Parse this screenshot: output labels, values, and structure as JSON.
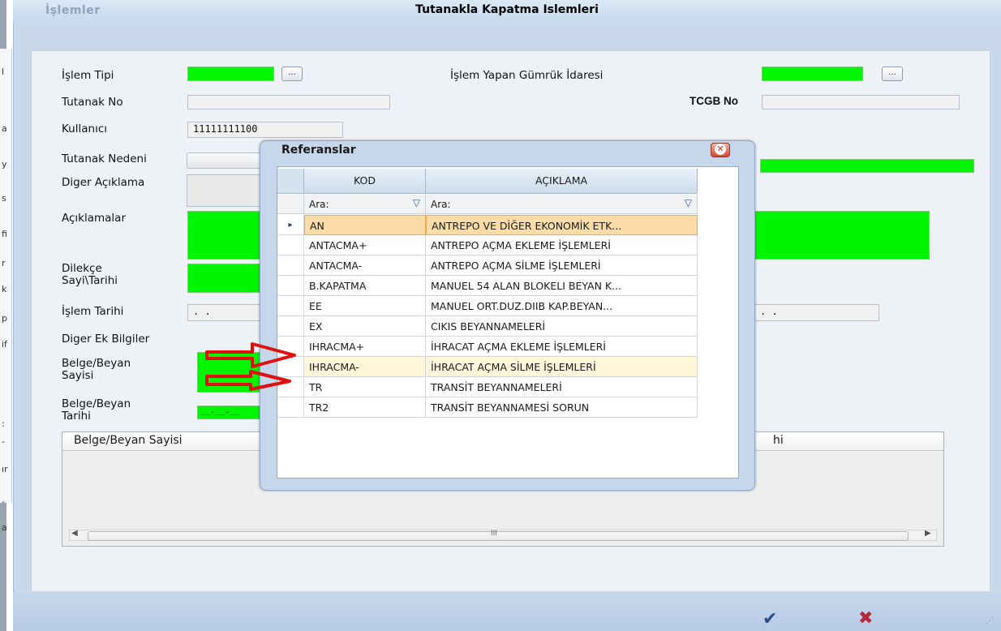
{
  "window": {
    "title_left": "İşlemler",
    "title": "Tutanakla Kapatma Islemleri"
  },
  "left_strip_letters": [
    "l",
    "a",
    "y",
    "s",
    "fi",
    "r",
    "k",
    "p",
    "if",
    ":",
    "-",
    "ır",
    "-",
    "a"
  ],
  "form": {
    "islem_tipi": "İşlem Tipi",
    "islem_yapan": "İşlem Yapan Gümrük İdaresi",
    "tutanak_no": "Tutanak No",
    "tcgb_no": "TCGB No",
    "kullanici": "Kullanıcı",
    "kullanici_value": "11111111100",
    "tutanak_nedeni": "Tutanak Nedeni",
    "diger_aciklama": "Diger Açıklama",
    "aciklamalar": "Açıklamalar",
    "dilekce_1": "Dilekçe",
    "dilekce_2": "Sayi\\Tarihi",
    "islem_tarihi": "İşlem Tarihi",
    "islem_tarihi_value": ". .",
    "right_date_value": ". .",
    "diger_ek": "Diger Ek Bilgiler",
    "belge_sayisi_1": "Belge/Beyan",
    "belge_sayisi_2": "Sayisi",
    "belge_tarihi_1": "Belge/Beyan",
    "belge_tarihi_2": "Tarihi",
    "dots_label": "...",
    "date_mask": "__.__.__"
  },
  "grid": {
    "col1": "Belge/Beyan Sayisi",
    "col2_partial": "hi",
    "scroll_grip": "III"
  },
  "dialog": {
    "title": "Referanslar",
    "close": "✕",
    "col_kod": "KOD",
    "col_aciklama": "AÇIKLAMA",
    "filter_placeholder": "Ara:",
    "rows": [
      {
        "kod": "AN",
        "aciklama": "ANTREPO VE DİĞER EKONOMİK ETK..."
      },
      {
        "kod": "ANTACMA+",
        "aciklama": "ANTREPO AÇMA EKLEME İŞLEMLERİ"
      },
      {
        "kod": "ANTACMA-",
        "aciklama": "ANTREPO AÇMA SİLME İŞLEMLERİ"
      },
      {
        "kod": "B.KAPATMA",
        "aciklama": "MANUEL 54 ALAN BLOKELI BEYAN K..."
      },
      {
        "kod": "EE",
        "aciklama": "MANUEL ORT.DUZ.DIIB KAP.BEYAN..."
      },
      {
        "kod": "EX",
        "aciklama": "CIKIS BEYANNAMELERİ"
      },
      {
        "kod": "IHRACMA+",
        "aciklama": "İHRACAT AÇMA EKLEME İŞLEMLERİ"
      },
      {
        "kod": "IHRACMA-",
        "aciklama": "İHRACAT AÇMA SİLME İŞLEMLERİ"
      },
      {
        "kod": "TR",
        "aciklama": "TRANSİT BEYANNAMELERİ"
      },
      {
        "kod": "TR2",
        "aciklama": "TRANSİT BEYANNAMESİ SORUN"
      }
    ]
  },
  "colors": {
    "field_green": "#00f500",
    "selection": "#fbdca6",
    "arrow_red": "#e01010"
  },
  "icons": {
    "row_indicator": "▸",
    "filter": "▽",
    "ok": "✔",
    "cancel": "✖"
  }
}
